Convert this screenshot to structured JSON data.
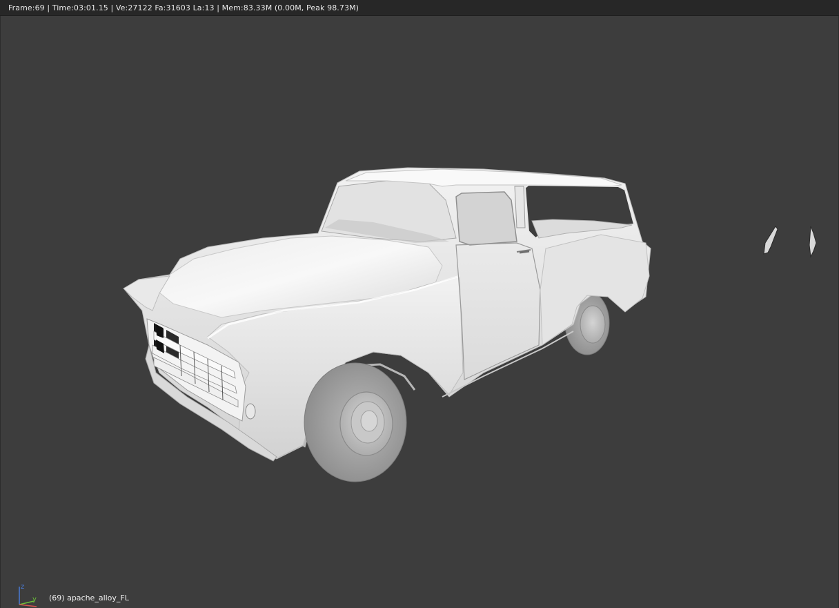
{
  "header": {
    "info": "Frame:69 | Time:03:01.15 | Ve:27122 Fa:31603 La:13 | Mem:83.33M (0.00M, Peak 98.73M)"
  },
  "viewport": {
    "background": "#3d3d3d",
    "object_label": "(69) apache_alloy_FL",
    "gizmo": {
      "z_label": "z",
      "y_label": "y",
      "x_color": "#d9534f",
      "y_color": "#6bbf3a",
      "z_color": "#4a7bd6"
    }
  }
}
